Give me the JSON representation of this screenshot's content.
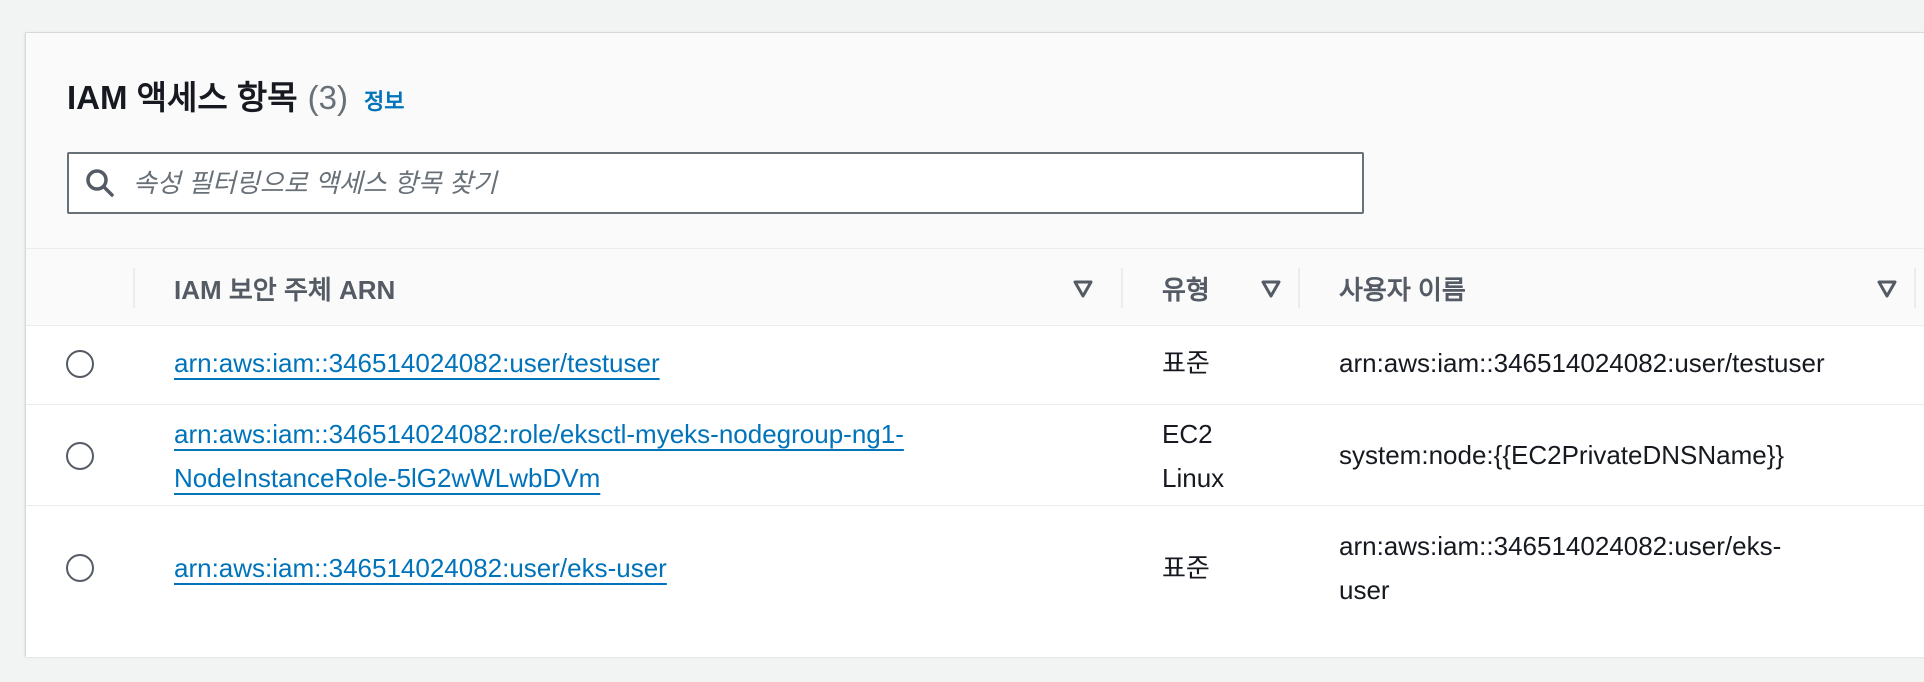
{
  "header": {
    "title": "IAM 액세스 항목",
    "count": "(3)",
    "info_link": "정보"
  },
  "search": {
    "placeholder": "속성 필터링으로 액세스 항목 찾기",
    "icon": "search-icon"
  },
  "table": {
    "columns": [
      {
        "label": "IAM 보안 주체 ARN"
      },
      {
        "label": "유형"
      },
      {
        "label": "사용자 이름"
      }
    ],
    "rows": [
      {
        "arn_line1": "arn:aws:iam::346514024082:user/testuser",
        "arn_line2": "",
        "type_line1": "표준",
        "type_line2": "",
        "username_line1": "arn:aws:iam::346514024082:user/testuser",
        "username_line2": ""
      },
      {
        "arn_line1": "arn:aws:iam::346514024082:role/eksctl-myeks-nodegroup-ng1-",
        "arn_line2": "NodeInstanceRole-5lG2wWLwbDVm",
        "type_line1": "EC2",
        "type_line2": "Linux",
        "username_line1": "system:node:{{EC2PrivateDNSName}}",
        "username_line2": ""
      },
      {
        "arn_line1": "arn:aws:iam::346514024082:user/eks-user",
        "arn_line2": "",
        "type_line1": "표준",
        "type_line2": "",
        "username_line1": "arn:aws:iam::346514024082:user/eks-",
        "username_line2": "user"
      }
    ]
  },
  "colors": {
    "link": "#0073bb",
    "header_bg": "#fafafa",
    "border": "#eaeded"
  }
}
